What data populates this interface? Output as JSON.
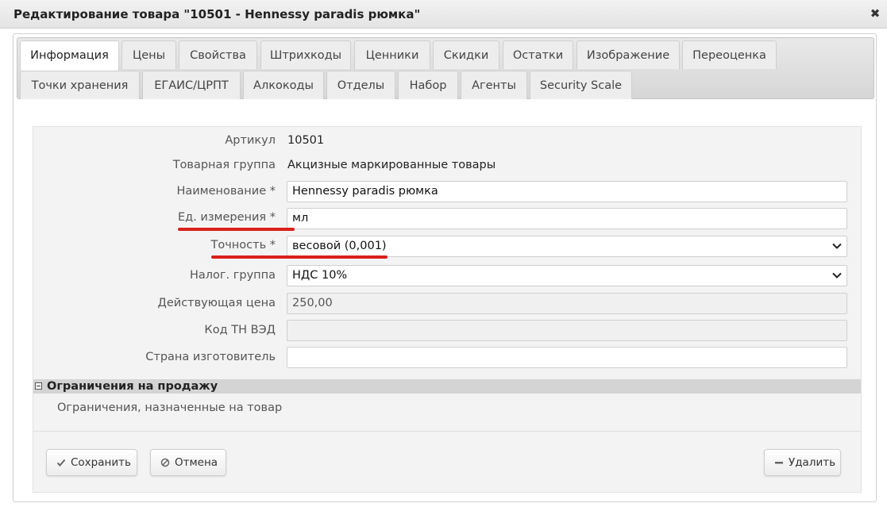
{
  "window": {
    "title": "Редактирование товара \"10501 - Hennessy paradis рюмка\"",
    "close_symbol": "✖"
  },
  "tabs": [
    {
      "label": "Информация",
      "active": true
    },
    {
      "label": "Цены"
    },
    {
      "label": "Свойства"
    },
    {
      "label": "Штрихкоды"
    },
    {
      "label": "Ценники"
    },
    {
      "label": "Скидки"
    },
    {
      "label": "Остатки"
    },
    {
      "label": "Изображение"
    },
    {
      "label": "Переоценка"
    },
    {
      "label": "Точки хранения"
    },
    {
      "label": "ЕГАИС/ЦРПТ"
    },
    {
      "label": "Алкокоды"
    },
    {
      "label": "Отделы"
    },
    {
      "label": "Набор"
    },
    {
      "label": "Агенты"
    },
    {
      "label": "Security Scale"
    }
  ],
  "form": {
    "article": {
      "label": "Артикул",
      "value": "10501"
    },
    "product_group": {
      "label": "Товарная группа",
      "value": "Акцизные маркированные товары"
    },
    "name": {
      "label": "Наименование *",
      "value": "Hennessy paradis рюмка"
    },
    "unit": {
      "label": "Ед. измерения *",
      "value": "мл"
    },
    "precision": {
      "label": "Точность *",
      "value": "весовой (0,001)"
    },
    "tax_group": {
      "label": "Налог. группа",
      "value": "НДС 10%"
    },
    "current_price": {
      "label": "Действующая цена",
      "value": "250,00"
    },
    "tn_ved_code": {
      "label": "Код ТН ВЭД",
      "value": ""
    },
    "country": {
      "label": "Страна изготовитель",
      "value": ""
    }
  },
  "annotation_color": "#d9201a",
  "restrictions": {
    "title": "Ограничения на продажу",
    "note": "Ограничения, назначенные на товар"
  },
  "buttons": {
    "save": "Сохранить",
    "cancel": "Отмена",
    "delete": "Удалить"
  },
  "icons": {
    "save": "check-icon",
    "cancel": "cancel-icon",
    "delete": "minus-icon",
    "collapse": "collapse-icon",
    "close": "close-icon",
    "select": "chevron-down-icon"
  }
}
